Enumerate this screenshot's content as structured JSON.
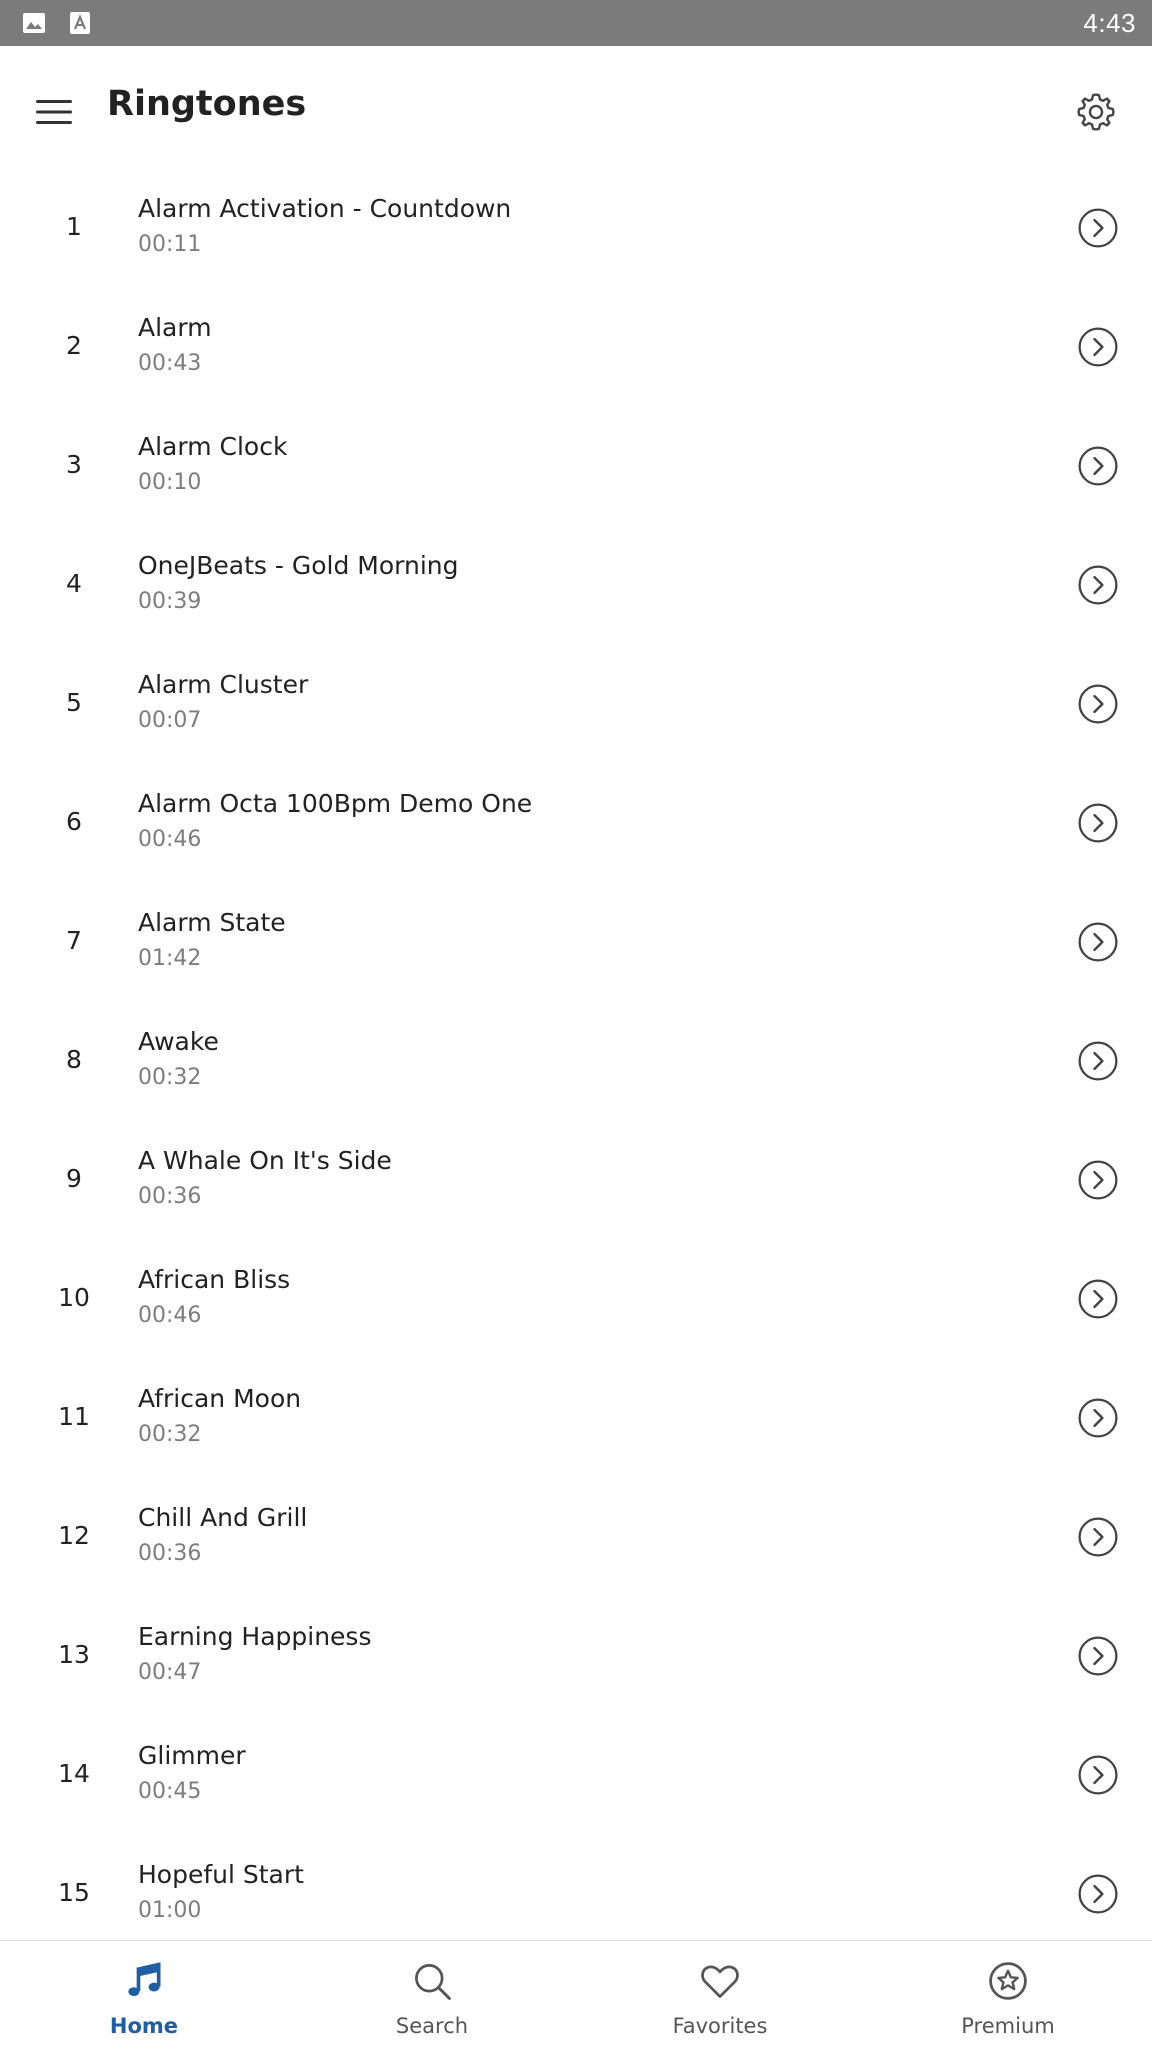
{
  "status_bar": {
    "time": "4:43",
    "icons": [
      "image-icon",
      "a-icon"
    ]
  },
  "app_bar": {
    "title": "Ringtones",
    "menu_icon": "hamburger-menu-icon",
    "settings_icon": "gear-icon"
  },
  "ringtones": [
    {
      "num": "1",
      "title": "Alarm Activation - Countdown",
      "duration": "00:11"
    },
    {
      "num": "2",
      "title": "Alarm",
      "duration": "00:43"
    },
    {
      "num": "3",
      "title": "Alarm Clock",
      "duration": "00:10"
    },
    {
      "num": "4",
      "title": "OneJBeats - Gold Morning",
      "duration": "00:39"
    },
    {
      "num": "5",
      "title": "Alarm Cluster",
      "duration": "00:07"
    },
    {
      "num": "6",
      "title": "Alarm Octa 100Bpm Demo One",
      "duration": "00:46"
    },
    {
      "num": "7",
      "title": "Alarm State",
      "duration": "01:42"
    },
    {
      "num": "8",
      "title": "Awake",
      "duration": "00:32"
    },
    {
      "num": "9",
      "title": "A Whale On It's Side",
      "duration": "00:36"
    },
    {
      "num": "10",
      "title": "African Bliss",
      "duration": "00:46"
    },
    {
      "num": "11",
      "title": "African Moon",
      "duration": "00:32"
    },
    {
      "num": "12",
      "title": "Chill And Grill",
      "duration": "00:36"
    },
    {
      "num": "13",
      "title": "Earning Happiness",
      "duration": "00:47"
    },
    {
      "num": "14",
      "title": "Glimmer",
      "duration": "00:45"
    },
    {
      "num": "15",
      "title": "Hopeful Start",
      "duration": "01:00"
    }
  ],
  "bottom_nav": {
    "items": [
      {
        "label": "Home",
        "icon": "music-note-icon",
        "active": true
      },
      {
        "label": "Search",
        "icon": "search-icon",
        "active": false
      },
      {
        "label": "Favorites",
        "icon": "heart-icon",
        "active": false
      },
      {
        "label": "Premium",
        "icon": "star-badge-icon",
        "active": false
      }
    ]
  },
  "colors": {
    "status_bar": "#7b7b7b",
    "accent": "#1e5fa3",
    "text_primary": "#222222",
    "text_secondary": "#7d7d7d"
  }
}
